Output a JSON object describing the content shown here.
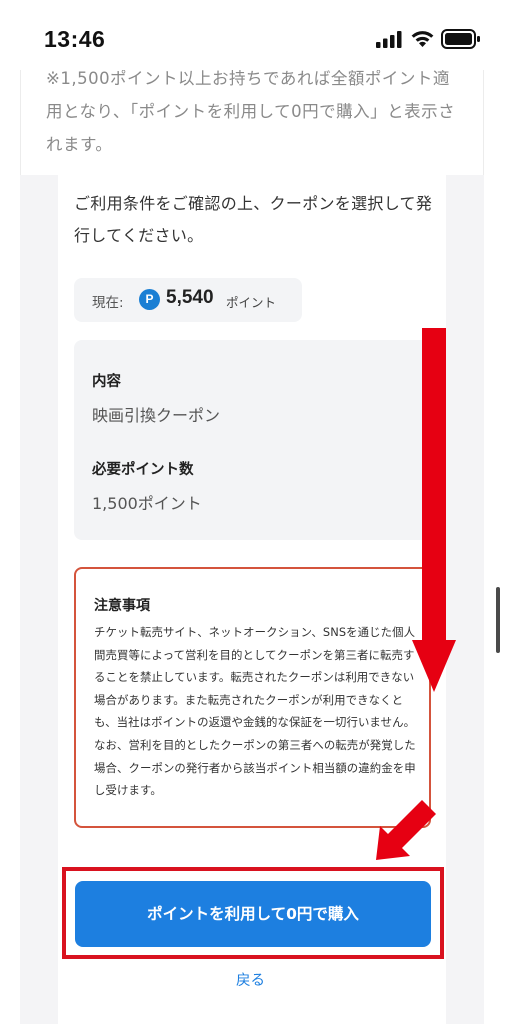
{
  "status_bar": {
    "time": "13:46"
  },
  "top_note": "※1,500ポイント以上お持ちであれば全額ポイント適用となり、「ポイントを利用して0円で購入」と表示されます。",
  "intro": "ご利用条件をご確認の上、クーポンを選択して発行してください。",
  "points": {
    "label": "現在:",
    "icon": "P",
    "value": "5,540",
    "unit": "ポイント"
  },
  "details": {
    "content_heading": "内容",
    "content_value": "映画引換クーポン",
    "required_heading": "必要ポイント数",
    "required_value": "1,500ポイント"
  },
  "notice": {
    "title": "注意事項",
    "body": "チケット転売サイト、ネットオークション、SNSを通じた個人間売買等によって営利を目的としてクーポンを第三者に転売することを禁止しています。転売されたクーポンは利用できない場合があります。また転売されたクーポンが利用できなくとも、当社はポイントの返還や金銭的な保証を一切行いません。なお、営利を目的としたクーポンの第三者への転売が発覚した場合、クーポンの発行者から該当ポイント相当額の違約金を申し受けます。"
  },
  "buy_button_label": "ポイントを利用して0円で購入",
  "back_label": "戻る",
  "colors": {
    "accent": "#1d7fe0",
    "annotation": "#d9121f",
    "notice_border": "#d4543c"
  }
}
